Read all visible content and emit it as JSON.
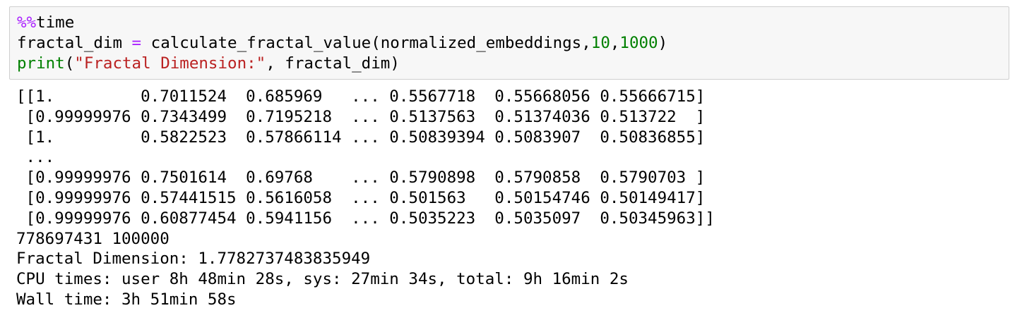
{
  "input_cell": {
    "line1": {
      "magic_prefix": "%%",
      "magic_name": "time"
    },
    "line2": {
      "var": "fractal_dim",
      "eq": " = ",
      "call": "calculate_fractal_value(normalized_embeddings,",
      "arg1": "10",
      "comma": ",",
      "arg2": "1000",
      "close": ")"
    },
    "line3": {
      "func": "print",
      "open": "(",
      "str": "\"Fractal Dimension:\"",
      "rest": ", fractal_dim)"
    }
  },
  "output": {
    "lines": [
      "[[1.         0.7011524  0.685969   ... 0.5567718  0.55668056 0.55666715]",
      " [0.99999976 0.7343499  0.7195218  ... 0.5137563  0.51374036 0.513722  ]",
      " [1.         0.5822523  0.57866114 ... 0.50839394 0.5083907  0.50836855]",
      " ...",
      " [0.99999976 0.7501614  0.69768    ... 0.5790898  0.5790858  0.5790703 ]",
      " [0.99999976 0.57441515 0.5616058  ... 0.501563   0.50154746 0.50149417]",
      " [0.99999976 0.60877454 0.5941156  ... 0.5035223  0.5035097  0.50345963]]",
      "778697431 100000",
      "Fractal Dimension: 1.7782737483835949",
      "CPU times: user 8h 48min 28s, sys: 27min 34s, total: 9h 16min 2s",
      "Wall time: 3h 51min 58s"
    ]
  }
}
